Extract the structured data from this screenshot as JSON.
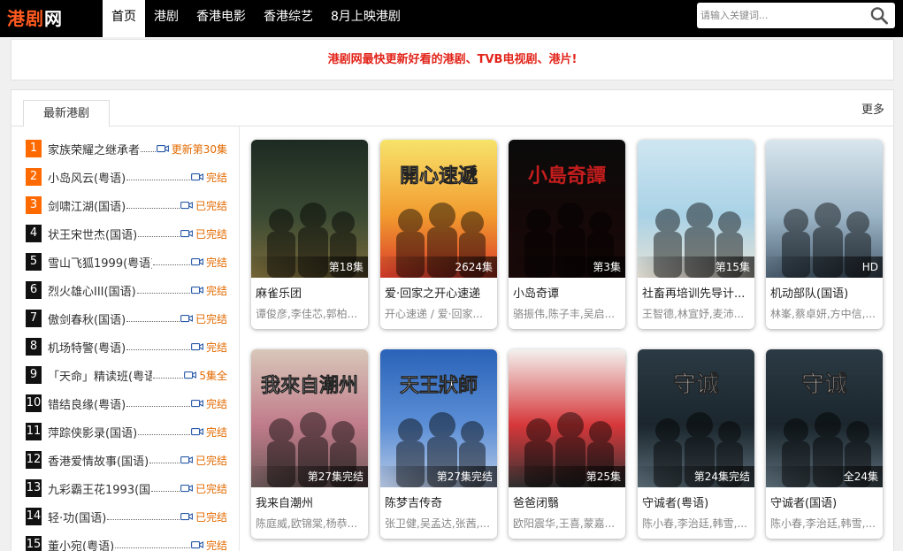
{
  "header": {
    "logo_part1": "港剧",
    "logo_part2": "网",
    "nav": [
      {
        "label": "首页",
        "active": true
      },
      {
        "label": "港剧",
        "active": false
      },
      {
        "label": "香港电影",
        "active": false
      },
      {
        "label": "香港综艺",
        "active": false
      },
      {
        "label": "8月上映港剧",
        "active": false
      }
    ],
    "search_placeholder": "请输入关键词..."
  },
  "notice": "港剧网最快更新好看的港剧、TVB电视剧、港片!",
  "section": {
    "tab_label": "最新港剧",
    "more_label": "更多"
  },
  "ranking": [
    {
      "num": "1",
      "title": "家族荣耀之继承者",
      "status": "更新第30集"
    },
    {
      "num": "2",
      "title": "小岛风云(粤语)",
      "status": "完结"
    },
    {
      "num": "3",
      "title": "剑啸江湖(国语)",
      "status": "已完结"
    },
    {
      "num": "4",
      "title": "状王宋世杰(国语)",
      "status": "已完结"
    },
    {
      "num": "5",
      "title": "雪山飞狐1999(粤语)",
      "status": "完结"
    },
    {
      "num": "6",
      "title": "烈火雄心III(国语)",
      "status": "完结"
    },
    {
      "num": "7",
      "title": "傲剑春秋(国语)",
      "status": "已完结"
    },
    {
      "num": "8",
      "title": "机场特警(粤语)",
      "status": "完结"
    },
    {
      "num": "9",
      "title": "「天命」精读班(粤语)",
      "status": "5集全"
    },
    {
      "num": "10",
      "title": "错结良缘(粤语)",
      "status": "完结"
    },
    {
      "num": "11",
      "title": "萍踪侠影录(国语)",
      "status": "完结"
    },
    {
      "num": "12",
      "title": "香港爱情故事(国语)",
      "status": "已完结"
    },
    {
      "num": "13",
      "title": "九彩霸王花1993(国",
      "status": "已完结"
    },
    {
      "num": "14",
      "title": "轻·功(国语)",
      "status": "已完结"
    },
    {
      "num": "15",
      "title": "董小宛(粤语)",
      "status": "完结"
    }
  ],
  "cards": [
    {
      "title": "麻雀乐团",
      "cast": "谭俊彦,李佳芯,郭柏...",
      "ep": "第18集",
      "poster_text": "",
      "colors": [
        "#1d2a22",
        "#3b4a33",
        "#7a6a3a"
      ]
    },
    {
      "title": "爱·回家之开心速递",
      "cast": "开心速递 / 爱·回家...",
      "ep": "2624集",
      "poster_text": "開心速遞",
      "colors": [
        "#f7e36a",
        "#f29b2f",
        "#d83b2a"
      ]
    },
    {
      "title": "小岛奇谭",
      "cast": "骆振伟,陈子丰,吴启...",
      "ep": "第3集",
      "poster_text": "小島奇譚",
      "colors": [
        "#0b0b0b",
        "#140808",
        "#1b0a0a"
      ]
    },
    {
      "title": "社畜再培训先导计...",
      "cast": "王智德,林宣妤,麦沛...",
      "ep": "第15集",
      "poster_text": "",
      "colors": [
        "#cfe6f1",
        "#a9d2e6",
        "#e7e2d6"
      ]
    },
    {
      "title": "机动部队(国语)",
      "cast": "林峯,蔡卓妍,方中信,...",
      "ep": "HD",
      "poster_text": "",
      "colors": [
        "#d9e6ee",
        "#9bb4c6",
        "#4d6274"
      ]
    },
    {
      "title": "我来自潮州",
      "cast": "陈庭威,欧锦棠,杨恭...",
      "ep": "第27集完结",
      "poster_text": "我來自潮州",
      "colors": [
        "#d8c7b9",
        "#c07b8a",
        "#6e5a5a"
      ]
    },
    {
      "title": "陈梦吉传奇",
      "cast": "张卫健,吴孟达,张茜,...",
      "ep": "第27集完结",
      "poster_text": "天王狀師",
      "colors": [
        "#2a63b8",
        "#5c8fd6",
        "#b8c9e6"
      ]
    },
    {
      "title": "爸爸闭翳",
      "cast": "欧阳震华,王喜,蒙嘉...",
      "ep": "第25集",
      "poster_text": "",
      "colors": [
        "#f3f1ee",
        "#d6373a",
        "#333333"
      ]
    },
    {
      "title": "守诚者(粤语)",
      "cast": "陈小春,李治廷,韩雪,...",
      "ep": "第24集完结",
      "poster_text": "守诚",
      "colors": [
        "#2b3a44",
        "#1b262d",
        "#5b6d78"
      ]
    },
    {
      "title": "守诚者(国语)",
      "cast": "陈小春,李治廷,韩雪,...",
      "ep": "全24集",
      "poster_text": "守诚",
      "colors": [
        "#2b3a44",
        "#1b262d",
        "#5b6d78"
      ]
    }
  ]
}
